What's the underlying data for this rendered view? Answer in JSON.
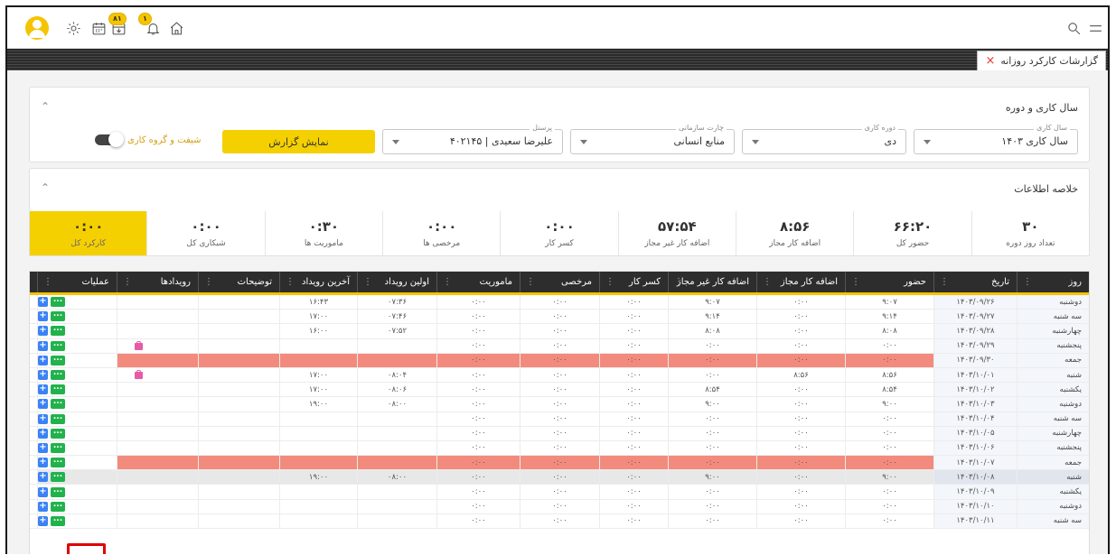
{
  "topbar": {
    "badge_calendar": "۸۱",
    "badge_bell": "۱",
    "icons": [
      "user-avatar",
      "settings-icon",
      "calendar-icon",
      "calendar-download-icon",
      "bell-icon",
      "home-icon",
      "search-icon",
      "menu-icon"
    ]
  },
  "tab": {
    "label": "گزارشات کارکرد روزانه",
    "close": "×"
  },
  "filters": {
    "panel_title": "سال کاری و دوره",
    "year_label": "سال کاری",
    "year_value": "سال کاری ۱۴۰۳",
    "period_label": "دوره کاری",
    "period_value": "دی",
    "org_label": "چارت سازمانی",
    "org_value": "منابع انسانی",
    "personnel_label": "پرسنل",
    "personnel_value": "علیرضا سعیدی | ۴۰۲۱۴۵",
    "report_button": "نمایش گزارش",
    "shift_toggle_label": "شیفت و گروه کاری"
  },
  "summary": {
    "panel_title": "خلاصه اطلاعات",
    "cells": [
      {
        "value": "۳۰",
        "label": "تعداد روز دوره"
      },
      {
        "value": "۶۶:۲۰",
        "label": "حضور کل"
      },
      {
        "value": "۸:۵۶",
        "label": "اضافه کار مجاز"
      },
      {
        "value": "۵۷:۵۴",
        "label": "اضافه کار غیر مجاز"
      },
      {
        "value": "۰:۰۰",
        "label": "کسر کار"
      },
      {
        "value": "۰:۰۰",
        "label": "مرخصی ها"
      },
      {
        "value": "۰:۳۰",
        "label": "ماموریت ها"
      },
      {
        "value": "۰:۰۰",
        "label": "شبکاری کل"
      },
      {
        "value": "۰:۰۰",
        "label": "کارکرد کل"
      }
    ]
  },
  "table": {
    "columns": [
      "روز",
      "تاریخ",
      "حضور",
      "اضافه کار مجاز",
      "اضافه کار غیر مجاز",
      "کسر کار",
      "مرخصی",
      "ماموریت",
      "اولین رویداد",
      "آخرین رویداد",
      "توضیحات",
      "رویدادها",
      "عملیات"
    ],
    "rows": [
      {
        "day": "دوشنبه",
        "date": "۱۴۰۳/۰۹/۲۶",
        "presence": "۹:۰۷",
        "ot_ok": "۰:۰۰",
        "ot_bad": "۹:۰۷",
        "deficit": "۰:۰۰",
        "leave": "۰:۰۰",
        "mission": "۰:۰۰",
        "first": "۰۷:۳۶",
        "last": "۱۶:۴۳",
        "desc": "",
        "event": false,
        "type": "normal"
      },
      {
        "day": "سه شنبه",
        "date": "۱۴۰۳/۰۹/۲۷",
        "presence": "۹:۱۴",
        "ot_ok": "۰:۰۰",
        "ot_bad": "۹:۱۴",
        "deficit": "۰:۰۰",
        "leave": "۰:۰۰",
        "mission": "۰:۰۰",
        "first": "۰۷:۴۶",
        "last": "۱۷:۰۰",
        "desc": "",
        "event": false,
        "type": "normal"
      },
      {
        "day": "چهارشنبه",
        "date": "۱۴۰۳/۰۹/۲۸",
        "presence": "۸:۰۸",
        "ot_ok": "۰:۰۰",
        "ot_bad": "۸:۰۸",
        "deficit": "۰:۰۰",
        "leave": "۰:۰۰",
        "mission": "۰:۰۰",
        "first": "۰۷:۵۲",
        "last": "۱۶:۰۰",
        "desc": "",
        "event": false,
        "type": "normal"
      },
      {
        "day": "پنجشنبه",
        "date": "۱۴۰۳/۰۹/۲۹",
        "presence": "۰:۰۰",
        "ot_ok": "۰:۰۰",
        "ot_bad": "۰:۰۰",
        "deficit": "۰:۰۰",
        "leave": "۰:۰۰",
        "mission": "۰:۰۰",
        "first": "",
        "last": "",
        "desc": "",
        "event": true,
        "type": "normal"
      },
      {
        "day": "جمعه",
        "date": "۱۴۰۳/۰۹/۳۰",
        "presence": "۰:۰۰",
        "ot_ok": "۰:۰۰",
        "ot_bad": "۰:۰۰",
        "deficit": "۰:۰۰",
        "leave": "۰:۰۰",
        "mission": "۰:۰۰",
        "first": "",
        "last": "",
        "desc": "",
        "event": false,
        "type": "holiday"
      },
      {
        "day": "شنبه",
        "date": "۱۴۰۳/۱۰/۰۱",
        "presence": "۸:۵۶",
        "ot_ok": "۸:۵۶",
        "ot_bad": "۰:۰۰",
        "deficit": "۰:۰۰",
        "leave": "۰:۰۰",
        "mission": "۰:۰۰",
        "first": "۰۸:۰۴",
        "last": "۱۷:۰۰",
        "desc": "",
        "event": true,
        "type": "normal"
      },
      {
        "day": "یکشنبه",
        "date": "۱۴۰۳/۱۰/۰۲",
        "presence": "۸:۵۴",
        "ot_ok": "۰:۰۰",
        "ot_bad": "۸:۵۴",
        "deficit": "۰:۰۰",
        "leave": "۰:۰۰",
        "mission": "۰:۰۰",
        "first": "۰۸:۰۶",
        "last": "۱۷:۰۰",
        "desc": "",
        "event": false,
        "type": "normal"
      },
      {
        "day": "دوشنبه",
        "date": "۱۴۰۳/۱۰/۰۳",
        "presence": "۹:۰۰",
        "ot_ok": "۰:۰۰",
        "ot_bad": "۹:۰۰",
        "deficit": "۰:۰۰",
        "leave": "۰:۰۰",
        "mission": "۰:۰۰",
        "first": "۰۸:۰۰",
        "last": "۱۹:۰۰",
        "desc": "",
        "event": false,
        "type": "normal"
      },
      {
        "day": "سه شنبه",
        "date": "۱۴۰۳/۱۰/۰۴",
        "presence": "۰:۰۰",
        "ot_ok": "۰:۰۰",
        "ot_bad": "۰:۰۰",
        "deficit": "۰:۰۰",
        "leave": "۰:۰۰",
        "mission": "۰:۰۰",
        "first": "",
        "last": "",
        "desc": "",
        "event": false,
        "type": "normal"
      },
      {
        "day": "چهارشنبه",
        "date": "۱۴۰۳/۱۰/۰۵",
        "presence": "۰:۰۰",
        "ot_ok": "۰:۰۰",
        "ot_bad": "۰:۰۰",
        "deficit": "۰:۰۰",
        "leave": "۰:۰۰",
        "mission": "۰:۰۰",
        "first": "",
        "last": "",
        "desc": "",
        "event": false,
        "type": "normal"
      },
      {
        "day": "پنجشنبه",
        "date": "۱۴۰۳/۱۰/۰۶",
        "presence": "۰:۰۰",
        "ot_ok": "۰:۰۰",
        "ot_bad": "۰:۰۰",
        "deficit": "۰:۰۰",
        "leave": "۰:۰۰",
        "mission": "۰:۰۰",
        "first": "",
        "last": "",
        "desc": "",
        "event": false,
        "type": "normal"
      },
      {
        "day": "جمعه",
        "date": "۱۴۰۳/۱۰/۰۷",
        "presence": "۰:۰۰",
        "ot_ok": "۰:۰۰",
        "ot_bad": "۰:۰۰",
        "deficit": "۰:۰۰",
        "leave": "۰:۰۰",
        "mission": "۰:۰۰",
        "first": "",
        "last": "",
        "desc": "",
        "event": false,
        "type": "holiday"
      },
      {
        "day": "شنبه",
        "date": "۱۴۰۳/۱۰/۰۸",
        "presence": "۹:۰۰",
        "ot_ok": "۰:۰۰",
        "ot_bad": "۹:۰۰",
        "deficit": "۰:۰۰",
        "leave": "۰:۰۰",
        "mission": "۰:۰۰",
        "first": "۰۸:۰۰",
        "last": "۱۹:۰۰",
        "desc": "",
        "event": false,
        "type": "selected"
      },
      {
        "day": "یکشنبه",
        "date": "۱۴۰۳/۱۰/۰۹",
        "presence": "۰:۰۰",
        "ot_ok": "۰:۰۰",
        "ot_bad": "۰:۰۰",
        "deficit": "۰:۰۰",
        "leave": "۰:۰۰",
        "mission": "۰:۰۰",
        "first": "",
        "last": "",
        "desc": "",
        "event": false,
        "type": "normal"
      },
      {
        "day": "دوشنبه",
        "date": "۱۴۰۳/۱۰/۱۰",
        "presence": "۰:۰۰",
        "ot_ok": "۰:۰۰",
        "ot_bad": "۰:۰۰",
        "deficit": "۰:۰۰",
        "leave": "۰:۰۰",
        "mission": "۰:۰۰",
        "first": "",
        "last": "",
        "desc": "",
        "event": false,
        "type": "normal"
      },
      {
        "day": "سه شنبه",
        "date": "۱۴۰۳/۱۰/۱۱",
        "presence": "۰:۰۰",
        "ot_ok": "۰:۰۰",
        "ot_bad": "۰:۰۰",
        "deficit": "۰:۰۰",
        "leave": "۰:۰۰",
        "mission": "۰:۰۰",
        "first": "",
        "last": "",
        "desc": "",
        "event": false,
        "type": "normal"
      }
    ]
  },
  "ops": {
    "plus": "+",
    "more": "..."
  },
  "colors": {
    "accent": "#f5d000",
    "holiday": "#f28b7d",
    "header": "#2d2d2d",
    "plus": "#3b82f6",
    "more": "#22b24c"
  }
}
